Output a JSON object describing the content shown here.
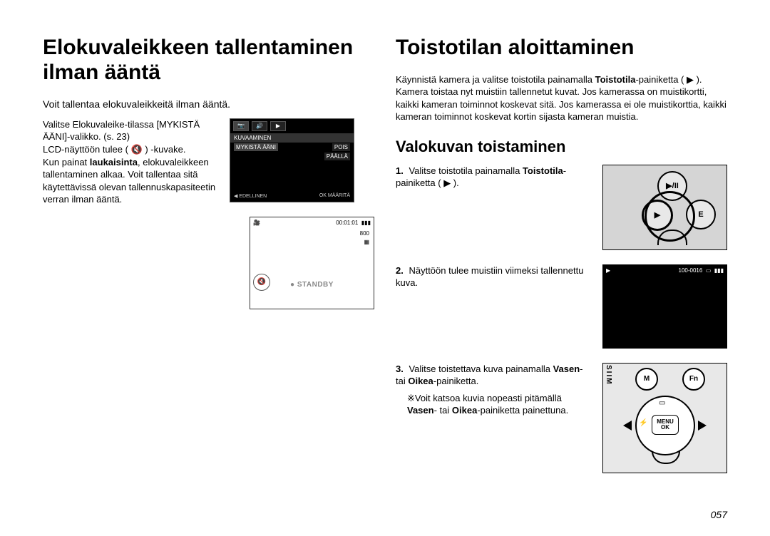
{
  "left": {
    "title": "Elokuvaleikkeen tallentaminen ilman ääntä",
    "intro": "Voit tallentaa elokuvaleikkeitä ilman ääntä.",
    "para1_a": "Valitse Elokuvaleike-tilassa [MYKISTÄ ÄÄNI]-valikko. (s. 23)",
    "para1_b": "LCD-näyttöön tulee ( 🔇 ) -kuvake.",
    "para1_c1": "Kun painat ",
    "para1_c_bold": "laukaisinta",
    "para1_c2": ", elokuvaleikkeen tallentaminen alkaa. Voit tallentaa sitä käytettävissä olevan tallennuskapasiteetin verran ilman ääntä.",
    "lcd_menu": {
      "heading": "KUVAAMINEN",
      "row_left": "MYKISTÄ ÄÄNI",
      "row_right1": "POIS",
      "row_right2": "PÄÄLLÄ",
      "footer_left": "◀  EDELLINEN",
      "footer_right": "OK  MÄÄRITÄ"
    },
    "lcd_standby": {
      "time": "00:01:01",
      "res": "800",
      "label": "● STANDBY"
    }
  },
  "right": {
    "title": "Toistotilan aloittaminen",
    "intro_a": "Käynnistä kamera ja valitse toistotila painamalla ",
    "intro_bold1": "Toistotila",
    "intro_b": "-painiketta ( ▶ ). Kamera toistaa nyt muistiin tallennetut kuvat. Jos kamerassa on muistikortti, kaikki kameran toiminnot koskevat sitä. Jos kamerassa ei ole muistikorttia, kaikki kameran toiminnot koskevat kortin sijasta kameran muistia.",
    "subheading": "Valokuvan toistaminen",
    "step1_num": "1.",
    "step1_a": "Valitse toistotila painamalla ",
    "step1_bold": "Toistotila",
    "step1_b": "-painiketta ( ▶ ).",
    "step2_num": "2.",
    "step2": "Näyttöön tulee muistiin viimeksi tallennettu kuva.",
    "playback_counter": "100-0016",
    "step3_num": "3.",
    "step3_a": "Valitse toistettava kuva painamalla ",
    "step3_bold1": "Vasen",
    "step3_mid": "- tai ",
    "step3_bold2": "Oikea",
    "step3_b": "-painiketta.",
    "step3_tip_a": "※Voit katsoa kuvia nopeasti pitämällä ",
    "step3_tip_bold1": "Vasen",
    "step3_tip_mid": "- tai ",
    "step3_tip_bold2": "Oikea",
    "step3_tip_b": "-painiketta painettuna.",
    "nav": {
      "m": "M",
      "fn": "Fn",
      "menu": "MENU",
      "ok": "OK"
    }
  },
  "page_number": "057"
}
